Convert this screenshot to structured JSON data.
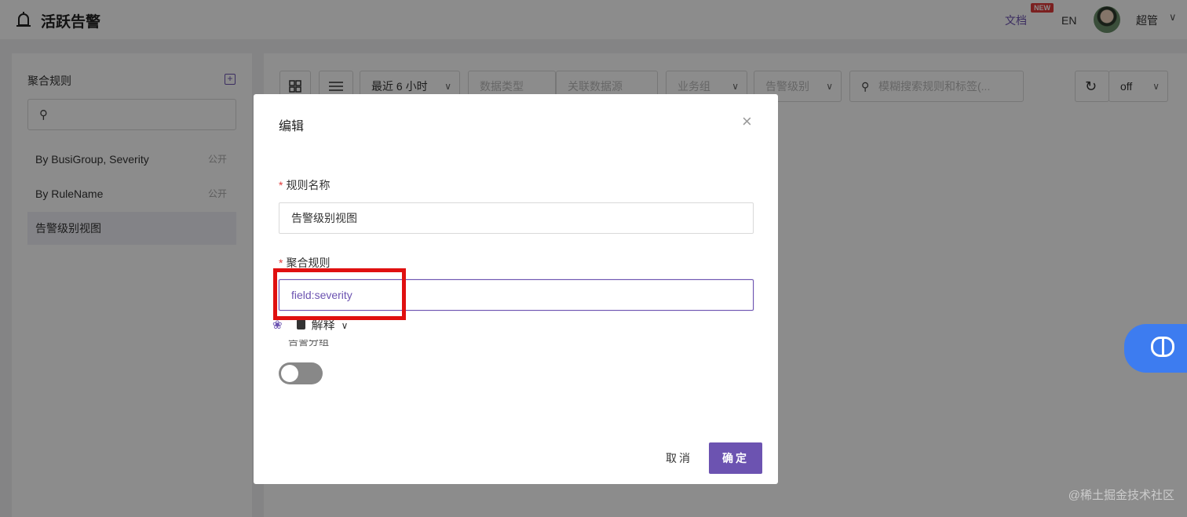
{
  "header": {
    "app_title": "活跃告警",
    "docs_label": "文档",
    "new_badge": "NEW",
    "lang_label": "EN",
    "user_name": "超管",
    "user_chevron": "∨"
  },
  "left_panel": {
    "title": "聚合规则",
    "add_icon": "⊞",
    "search_icon": "🔍",
    "rules": [
      {
        "label": "By BusiGroup, Severity",
        "tag": "公开"
      },
      {
        "label": "By RuleName",
        "tag": "公开"
      },
      {
        "label": "告警级别视图",
        "tag": ""
      }
    ]
  },
  "toolbar": {
    "time_range": "最近 6 小时",
    "filter1": "数据类型",
    "filter2": "关联数据源",
    "filter3": "业务组",
    "filter4": "告警级别",
    "search_placeholder": "模糊搜索规则和标签(...",
    "refresh_value": "off"
  },
  "modal": {
    "title": "编辑",
    "close": "×",
    "rule_name_label": "规则名称",
    "rule_name_value": "告警级别视图",
    "agg_rule_label": "聚合规则",
    "agg_rule_value": "field:severity",
    "explain_label": "解释",
    "hidden_label": "告警分组",
    "cancel_label": "取消",
    "ok_label": "确定"
  },
  "watermark": "@稀土掘金技术社区",
  "colors": {
    "accent": "#6c53b1",
    "highlight_border": "#e01010",
    "float_button": "#3d7cf0"
  }
}
